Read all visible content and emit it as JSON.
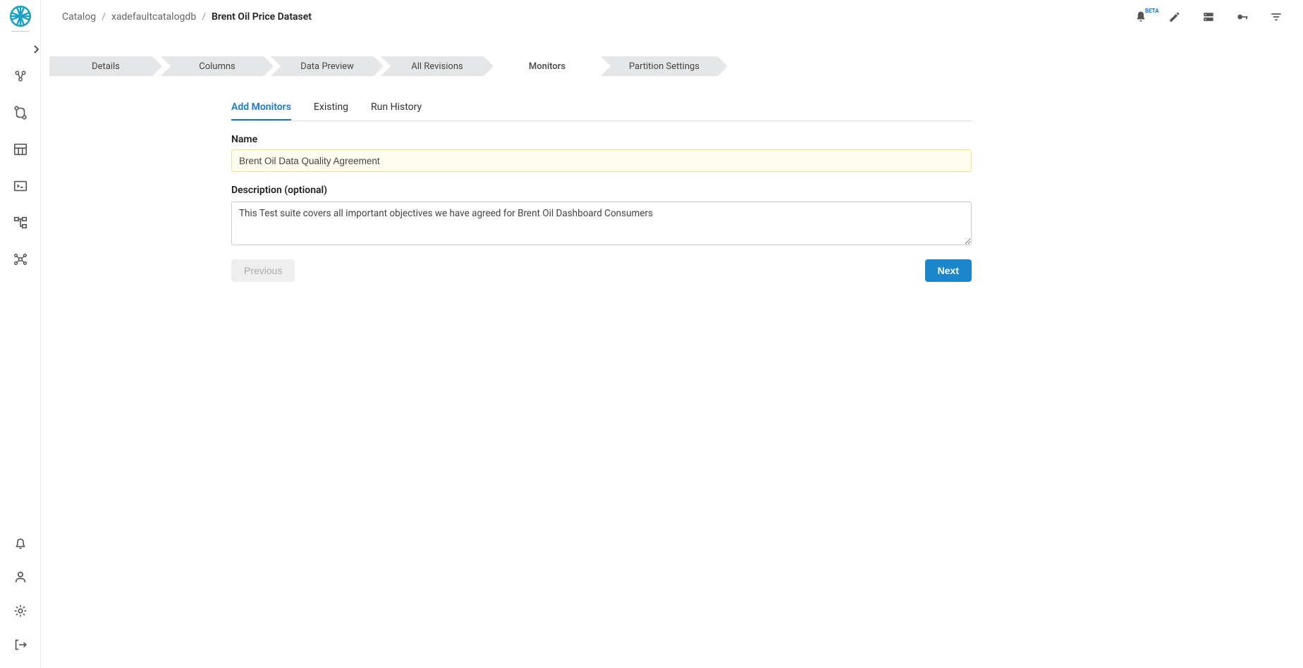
{
  "breadcrumb": {
    "root": "Catalog",
    "db": "xadefaultcatalogdb",
    "current": "Brent Oil Price Dataset"
  },
  "header_tools": {
    "beta": "BETA"
  },
  "tabs": [
    {
      "label": "Details"
    },
    {
      "label": "Columns"
    },
    {
      "label": "Data Preview"
    },
    {
      "label": "All Revisions"
    },
    {
      "label": "Monitors"
    },
    {
      "label": "Partition Settings"
    }
  ],
  "subtabs": {
    "add": "Add Monitors",
    "existing": "Existing",
    "history": "Run History"
  },
  "form": {
    "name_label": "Name",
    "name_value": "Brent Oil Data Quality Agreement",
    "desc_label": "Description (optional)",
    "desc_value": "This Test suite covers all important objectives we have agreed for Brent Oil Dashboard Consumers",
    "prev_btn": "Previous",
    "next_btn": "Next"
  }
}
